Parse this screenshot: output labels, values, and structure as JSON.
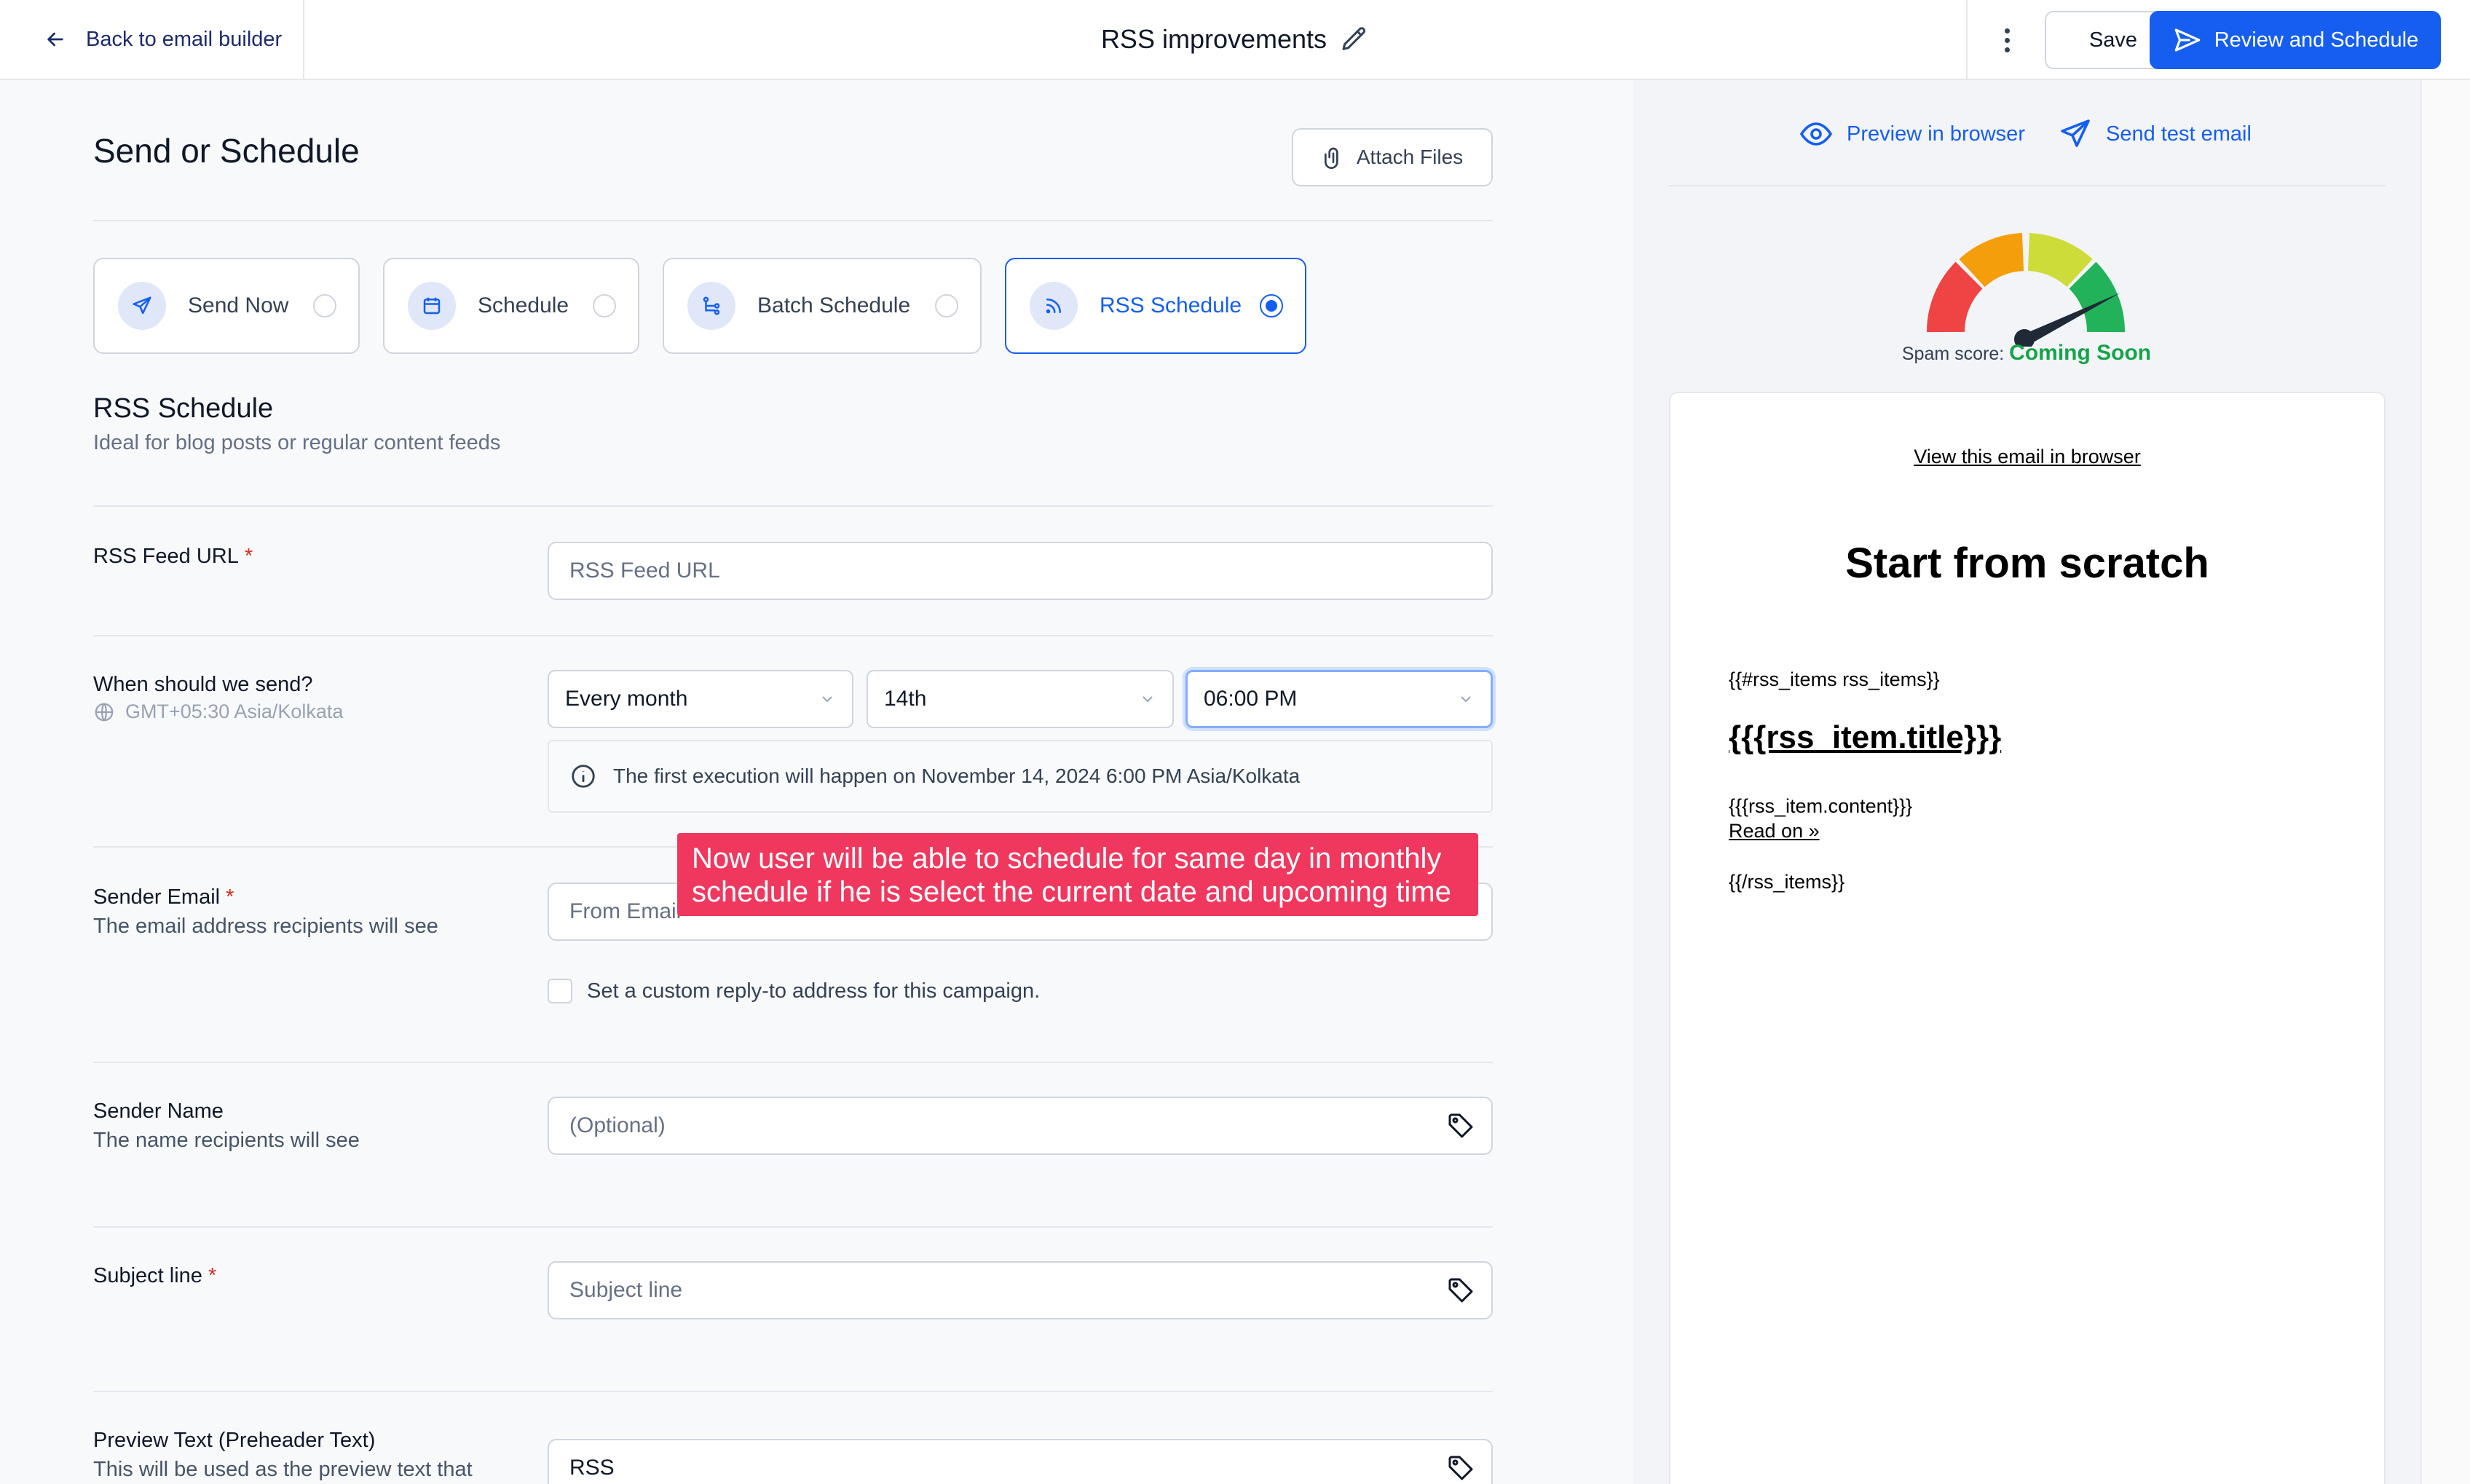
{
  "header": {
    "back_label": "Back to email builder",
    "title": "RSS improvements",
    "save_label": "Save",
    "review_label": "Review and Schedule"
  },
  "main": {
    "heading": "Send or Schedule",
    "attach_label": "Attach Files",
    "send_options": [
      {
        "label": "Send Now",
        "icon": "send-icon",
        "selected": false
      },
      {
        "label": "Schedule",
        "icon": "calendar-icon",
        "selected": false
      },
      {
        "label": "Batch Schedule",
        "icon": "batch-icon",
        "selected": false
      },
      {
        "label": "RSS Schedule",
        "icon": "rss-icon",
        "selected": true
      }
    ],
    "section_title": "RSS Schedule",
    "section_subtitle": "Ideal for blog posts or regular content feeds",
    "rss_feed": {
      "label": "RSS Feed URL",
      "placeholder": "RSS Feed URL"
    },
    "when": {
      "label": "When should we send?",
      "timezone": "GMT+05:30 Asia/Kolkata",
      "frequency": "Every month",
      "day": "14th",
      "time": "06:00 PM",
      "info": "The first execution will happen on November 14, 2024 6:00 PM Asia/Kolkata"
    },
    "sender_email": {
      "label": "Sender Email",
      "sublabel": "The email address recipients will see",
      "placeholder": "From Email",
      "reply_to_label": "Set a custom reply-to address for this campaign."
    },
    "sender_name": {
      "label": "Sender Name",
      "sublabel": "The name recipients will see",
      "placeholder": "(Optional)"
    },
    "subject": {
      "label": "Subject line",
      "placeholder": "Subject line"
    },
    "preview_text": {
      "label": "Preview Text (Preheader Text)",
      "sublabel": "This will be used as the preview text that",
      "value": "RSS"
    },
    "annotation": "Now user will be able to schedule for same day in monthly schedule if he is select the current date and upcoming time"
  },
  "preview": {
    "preview_browser_label": "Preview in browser",
    "send_test_label": "Send test email",
    "spam_label": "Spam score:",
    "spam_value": "Coming Soon",
    "view_in_browser": "View this email in browser",
    "email_title": "Start from scratch",
    "line1": "{{#rss_items rss_items}}",
    "item_title": "{{{rss_item.title}}}",
    "item_content": "{{{rss_item.content}}}",
    "read_on": "Read on »",
    "line_end": "{{/rss_items}}"
  },
  "colors": {
    "primary": "#155eef",
    "annotation": "#f0385f",
    "spam_good": "#16a34a"
  }
}
